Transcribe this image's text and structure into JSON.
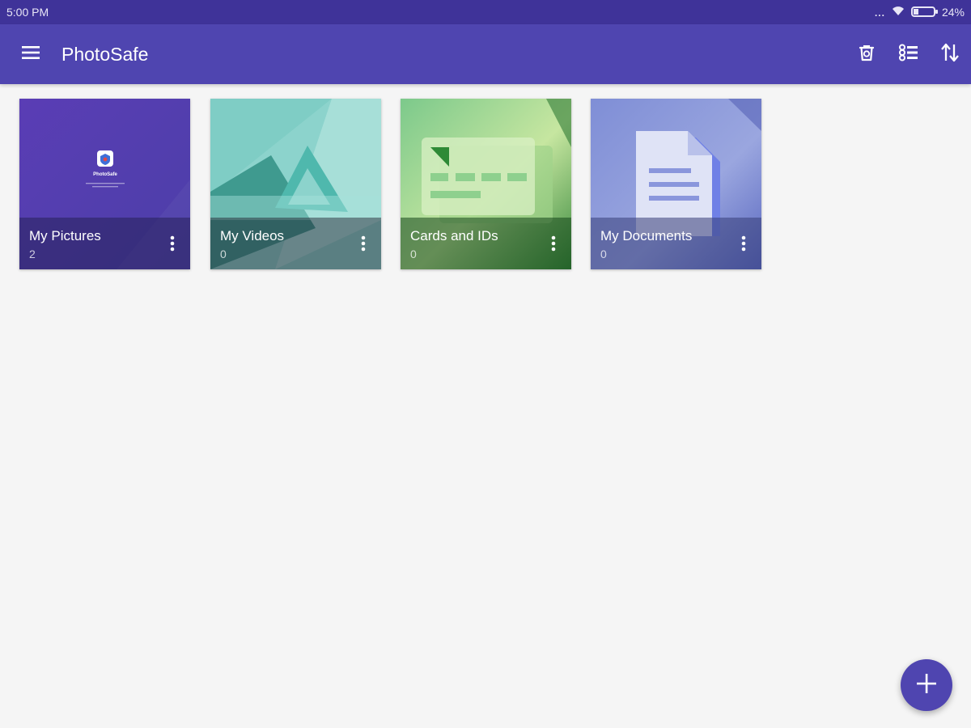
{
  "status_bar": {
    "time": "5:00 PM",
    "dots": "...",
    "battery_text": "24%",
    "battery_level": 0.24
  },
  "app_bar": {
    "title": "PhotoSafe",
    "icons": [
      "menu-icon",
      "trash-bin-icon",
      "checklist-icon",
      "sort-icon"
    ]
  },
  "albums": [
    {
      "name": "My Pictures",
      "count": "2",
      "thumb_app_name": "PhotoSafe",
      "icon": "more-vert-icon"
    },
    {
      "name": "My Videos",
      "count": "0",
      "icon": "more-vert-icon"
    },
    {
      "name": "Cards and IDs",
      "count": "0",
      "icon": "more-vert-icon"
    },
    {
      "name": "My Documents",
      "count": "0",
      "icon": "more-vert-icon"
    }
  ],
  "fab": {
    "icon": "plus-icon"
  },
  "colors": {
    "primary": "#4f45b0",
    "primary_dark": "#3f3399",
    "background": "#f5f5f5"
  }
}
